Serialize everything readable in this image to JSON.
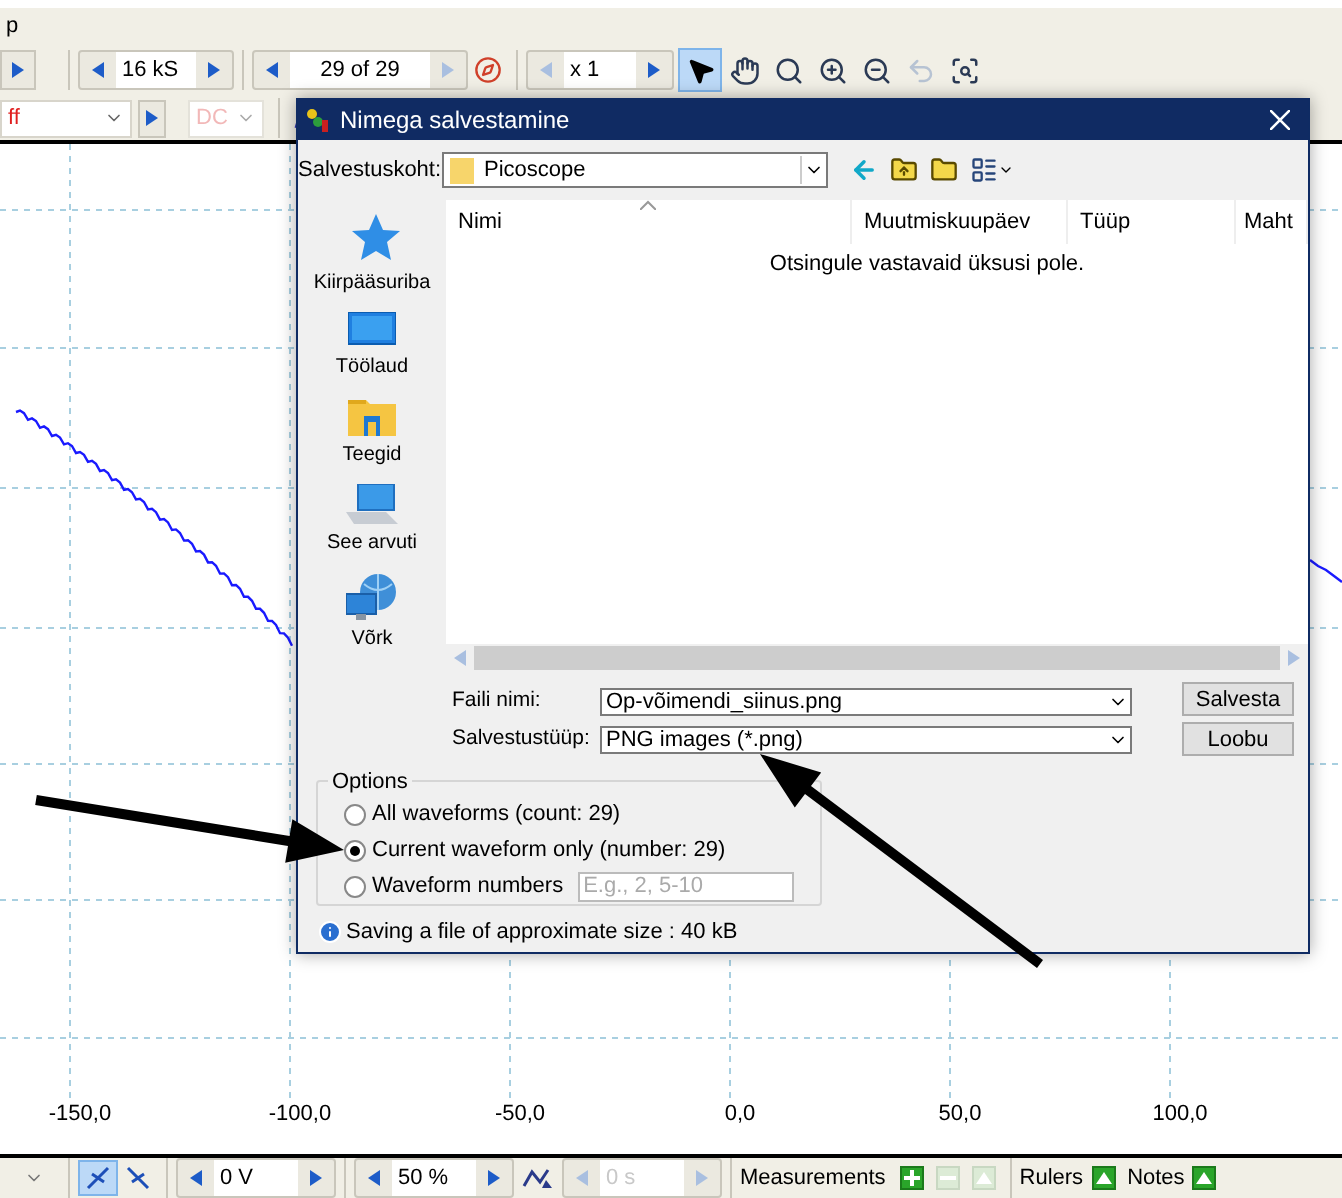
{
  "menu_bar": {
    "text": "p"
  },
  "toolbar": {
    "spinners": [
      {
        "value": "16 kS",
        "prev_disabled": false,
        "next_disabled": false
      },
      {
        "value": "29 of 29",
        "prev_disabled": false,
        "next_disabled": true
      },
      {
        "value": "x 1",
        "prev_disabled": true,
        "next_disabled": false
      }
    ],
    "tools": [
      {
        "kind": "pointer",
        "selected": true,
        "disabled": false
      },
      {
        "kind": "hand",
        "selected": false,
        "disabled": false
      },
      {
        "kind": "zoom-area",
        "selected": false,
        "disabled": false
      },
      {
        "kind": "zoom-in",
        "selected": false,
        "disabled": false
      },
      {
        "kind": "zoom-out",
        "selected": false,
        "disabled": false
      },
      {
        "kind": "undo",
        "selected": false,
        "disabled": true
      },
      {
        "kind": "zoom-fit",
        "selected": false,
        "disabled": false
      }
    ]
  },
  "channel_bar": {
    "range": {
      "value": "ff"
    },
    "coupling": {
      "value": "DC",
      "disabled": true
    }
  },
  "plot": {
    "x_axis_labels": [
      "-150,0",
      "-100,0",
      "-50,0",
      "0,0",
      "50,0",
      "100,0"
    ]
  },
  "dialog": {
    "title": "Nimega salvestamine",
    "location": {
      "label": "Salvestuskoht:",
      "value": "Picoscope"
    },
    "places": [
      {
        "kind": "quick-access",
        "label": "Kiirpääsuriba"
      },
      {
        "kind": "desktop",
        "label": "Töölaud"
      },
      {
        "kind": "libraries",
        "label": "Teegid"
      },
      {
        "kind": "computer",
        "label": "See arvuti"
      },
      {
        "kind": "network",
        "label": "Võrk"
      }
    ],
    "columns": [
      {
        "label": "Nimi",
        "sorted": true
      },
      {
        "label": "Muutmiskuupäev",
        "sorted": false
      },
      {
        "label": "Tüüp",
        "sorted": false
      },
      {
        "label": "Maht",
        "sorted": false
      }
    ],
    "empty_message": "Otsingule vastavaid üksusi pole.",
    "file_name": {
      "label": "Faili nimi:",
      "value": "Op-võimendi_siinus.png"
    },
    "file_type": {
      "label": "Salvestustüüp:",
      "value": "PNG images (*.png)"
    },
    "buttons": [
      "Salvesta",
      "Loobu"
    ],
    "options": {
      "title": "Options",
      "radios": [
        {
          "label": "All waveforms (count: 29)",
          "selected": false
        },
        {
          "label": "Current waveform only (number: 29)",
          "selected": true
        },
        {
          "label": "Waveform numbers",
          "selected": false,
          "placeholder": "E.g., 2, 5-10"
        }
      ]
    },
    "info": "Saving a file of approximate size : 40 kB"
  },
  "bottom_bar": {
    "triggers": [
      {
        "kind": "rising",
        "selected": true
      },
      {
        "kind": "falling",
        "selected": false
      }
    ],
    "spinners": [
      {
        "value": "0 V",
        "disabled": false
      },
      {
        "value": "50 %",
        "disabled": false
      },
      {
        "value": "0 s",
        "disabled": true
      }
    ],
    "measurements": {
      "label": "Measurements",
      "actions": [
        {
          "kind": "add",
          "disabled": false
        },
        {
          "kind": "remove",
          "disabled": true
        },
        {
          "kind": "edit",
          "disabled": true
        }
      ]
    },
    "rulers": {
      "label": "Rulers"
    },
    "notes": {
      "label": "Notes"
    }
  }
}
